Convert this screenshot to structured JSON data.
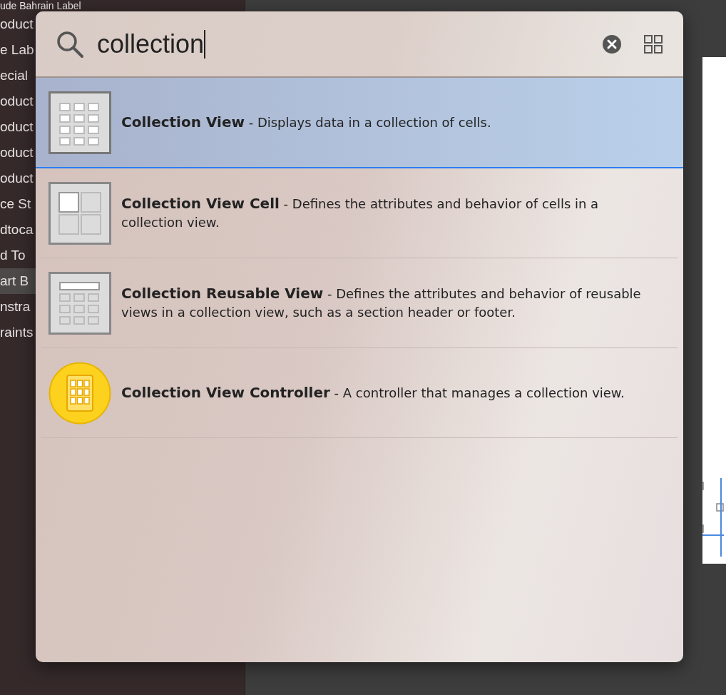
{
  "sidebar": {
    "items": [
      {
        "label": "ude Bahrain Label",
        "selected": false
      },
      {
        "label": "oduct",
        "selected": false
      },
      {
        "label": "e Lab",
        "selected": false
      },
      {
        "label": "ecial",
        "selected": false
      },
      {
        "label": "oduct",
        "selected": false
      },
      {
        "label": "oduct",
        "selected": false
      },
      {
        "label": "oduct",
        "selected": false
      },
      {
        "label": "oduct",
        "selected": false
      },
      {
        "label": "ce St",
        "selected": false
      },
      {
        "label": "dtoca",
        "selected": false
      },
      {
        "label": "d To",
        "selected": false
      },
      {
        "label": "art B",
        "selected": true
      },
      {
        "label": "nstra",
        "selected": false
      },
      {
        "label": "raints",
        "selected": false
      }
    ]
  },
  "library": {
    "search": {
      "value": "collection"
    },
    "results": [
      {
        "kind": "grid",
        "text": "**Collection View** - Displays data in a collection of cells.",
        "selected": true
      },
      {
        "kind": "cell",
        "text": "**Collection View Cell** - Defines the attributes and behavior of cells in a collection view.",
        "selected": false
      },
      {
        "kind": "reusable",
        "text": "**Collection Reusable View** - Defines the attributes and behavior of reusable views in a collection view, such as a section header or footer.",
        "selected": false
      },
      {
        "kind": "controller",
        "text": "**Collection View Controller** - A controller that manages a collection view.",
        "selected": false
      }
    ]
  }
}
